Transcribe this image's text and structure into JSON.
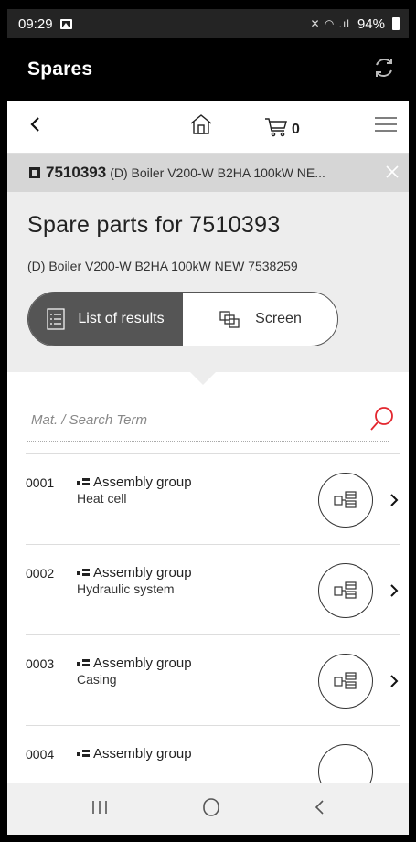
{
  "status": {
    "time": "09:29",
    "battery": "94%"
  },
  "appbar": {
    "title": "Spares"
  },
  "navbar": {
    "cart_count": "0"
  },
  "article": {
    "number": "7510393",
    "description": "(D) Boiler V200-W B2HA 100kW NE..."
  },
  "header": {
    "title": "Spare parts for 7510393",
    "subtitle": "(D) Boiler V200-W B2HA 100kW NEW 7538259",
    "toggle": {
      "list_label": "List of results",
      "screen_label": "Screen"
    }
  },
  "search": {
    "placeholder": "Mat. / Search Term",
    "value": ""
  },
  "results": [
    {
      "code": "0001",
      "group": "Assembly group",
      "name": "Heat cell"
    },
    {
      "code": "0002",
      "group": "Assembly group",
      "name": "Hydraulic system"
    },
    {
      "code": "0003",
      "group": "Assembly group",
      "name": "Casing"
    },
    {
      "code": "0004",
      "group": "Assembly group",
      "name": ""
    }
  ],
  "colors": {
    "appbar": "#000000",
    "toggle_active": "#555555",
    "search_icon": "#e3262e"
  }
}
